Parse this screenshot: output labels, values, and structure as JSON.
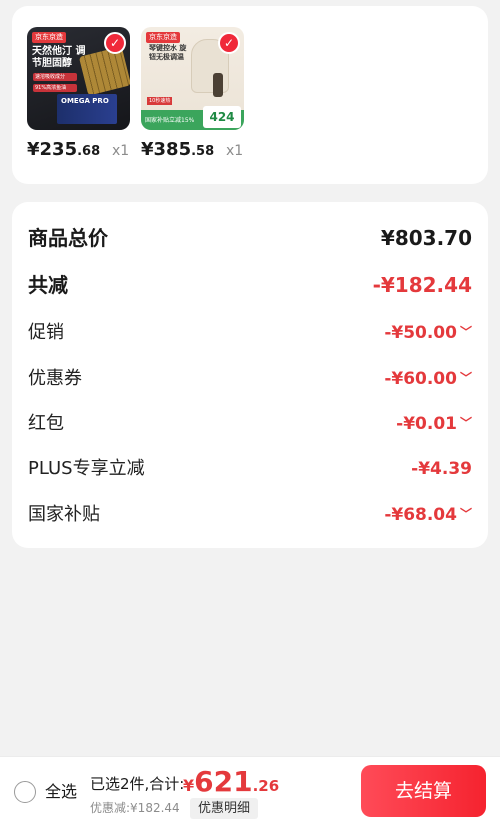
{
  "products": [
    {
      "brand_tag": "京东京造",
      "headline": "天然他汀 调节胆固醇",
      "badge_1": "速溶吸收成分",
      "badge_2": "91%高浓鱼油",
      "box_text": "OMEGA PRO",
      "price_currency": "¥",
      "price_int": "235",
      "price_dec": ".68",
      "quantity": "x1"
    },
    {
      "brand_tag": "京东京造",
      "headline": "琴键控水 旋钮无极调温",
      "red_label": "10秒速热",
      "green_text": "国家补贴立减15%",
      "big_number": "424",
      "price_currency": "¥",
      "price_int": "385",
      "price_dec": ".58",
      "quantity": "x1"
    }
  ],
  "summary": {
    "total_label": "商品总价",
    "total_value": "¥803.70",
    "reduce_label": "共减",
    "reduce_value": "-¥182.44",
    "items": [
      {
        "label": "促销",
        "value": "-¥50.00",
        "expandable": true
      },
      {
        "label": "优惠券",
        "value": "-¥60.00",
        "expandable": true
      },
      {
        "label": "红包",
        "value": "-¥0.01",
        "expandable": true
      },
      {
        "label": "PLUS专享立减",
        "value": "-¥4.39",
        "expandable": false
      },
      {
        "label": "国家补贴",
        "value": "-¥68.04",
        "expandable": true
      }
    ],
    "chevron_glyph": "﹀"
  },
  "bottom_bar": {
    "select_all": "全选",
    "selected_info": "已选2件,合计:",
    "total_currency": "¥",
    "total_int": "621",
    "total_dec": ".26",
    "discount_info": "优惠减:¥182.44",
    "detail_button": "优惠明细",
    "checkout_button": "去结算"
  },
  "colors": {
    "accent_red": "#e4393c",
    "checkout_gradient_start": "#ff4b58",
    "checkout_gradient_end": "#f5232f",
    "page_background": "#f2f2f2"
  },
  "icons": {
    "check_icon": "✓",
    "chevron_icon": "chevron-down"
  }
}
